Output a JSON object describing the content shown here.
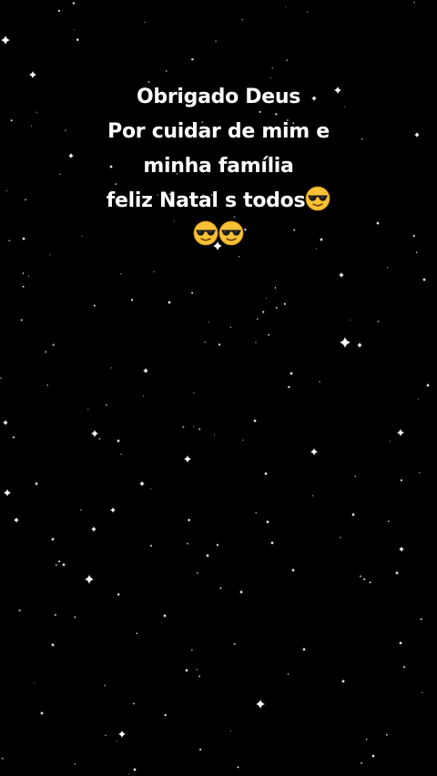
{
  "caption": {
    "line1": "Obrigado Deus",
    "line2": "Por cuidar de mim e",
    "line3": "minha família",
    "line4": "feliz Natal s todos",
    "line4_emoji": "smiling-face-with-sunglasses-icon",
    "line5_emojis": [
      "smiling-face-with-sunglasses-icon",
      "smiling-face-with-sunglasses-icon"
    ]
  },
  "colors": {
    "background": "#000000",
    "text": "#ffffff",
    "stars": "#ffffff",
    "emoji_face": "#f7c136",
    "emoji_glasses": "#1a1a1a"
  }
}
